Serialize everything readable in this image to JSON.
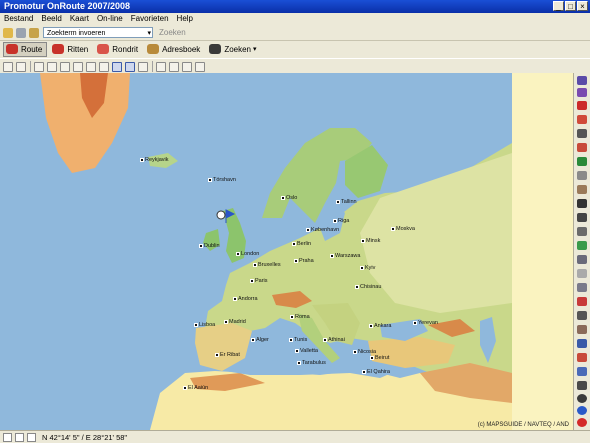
{
  "window": {
    "title": "Promotur OnRoute 2007/2008"
  },
  "menu": [
    "Bestand",
    "Beeld",
    "Kaart",
    "On-line",
    "Favorieten",
    "Help"
  ],
  "search": {
    "value": "Zoekterm invoeren",
    "button": "Zoeken"
  },
  "nav": {
    "route": "Route",
    "ritten": "Ritten",
    "rondrit": "Rondrit",
    "adresboek": "Adresboek",
    "zoeken": "Zoeken"
  },
  "map": {
    "copyright": "(c) MAPSGUIDE / NAVTEQ / AND",
    "cities": [
      {
        "name": "Reykjavik"
      },
      {
        "name": "Tórshavn"
      },
      {
        "name": "Oslo"
      },
      {
        "name": "Tallinn"
      },
      {
        "name": "Riga"
      },
      {
        "name": "København"
      },
      {
        "name": "Moskva"
      },
      {
        "name": "Minsk"
      },
      {
        "name": "Berlin"
      },
      {
        "name": "Dublin"
      },
      {
        "name": "London"
      },
      {
        "name": "Bruxelles"
      },
      {
        "name": "Praha"
      },
      {
        "name": "Warszawa"
      },
      {
        "name": "Kyiv"
      },
      {
        "name": "Paris"
      },
      {
        "name": "Chisinau"
      },
      {
        "name": "Andorra"
      },
      {
        "name": "Roma"
      },
      {
        "name": "Lisboa"
      },
      {
        "name": "Madrid"
      },
      {
        "name": "Ankara"
      },
      {
        "name": "Yerevan"
      },
      {
        "name": "Alger"
      },
      {
        "name": "Tunis"
      },
      {
        "name": "Valletta"
      },
      {
        "name": "Athinai"
      },
      {
        "name": "Nicosia"
      },
      {
        "name": "Beirut"
      },
      {
        "name": "Er Ribat"
      },
      {
        "name": "Tarabulus"
      },
      {
        "name": "El Aaiún"
      },
      {
        "name": "El Qahira"
      }
    ]
  },
  "status": {
    "coordinates": "N 42°14' 5\" / E 28°21' 58\""
  },
  "colors": {
    "sea": "#8fb8dc",
    "land_low": "#7dba62",
    "land_mid": "#e8c77a",
    "land_high": "#d88a4a",
    "desert": "#f7eaa6",
    "titlebar": "#1a4fd6"
  }
}
